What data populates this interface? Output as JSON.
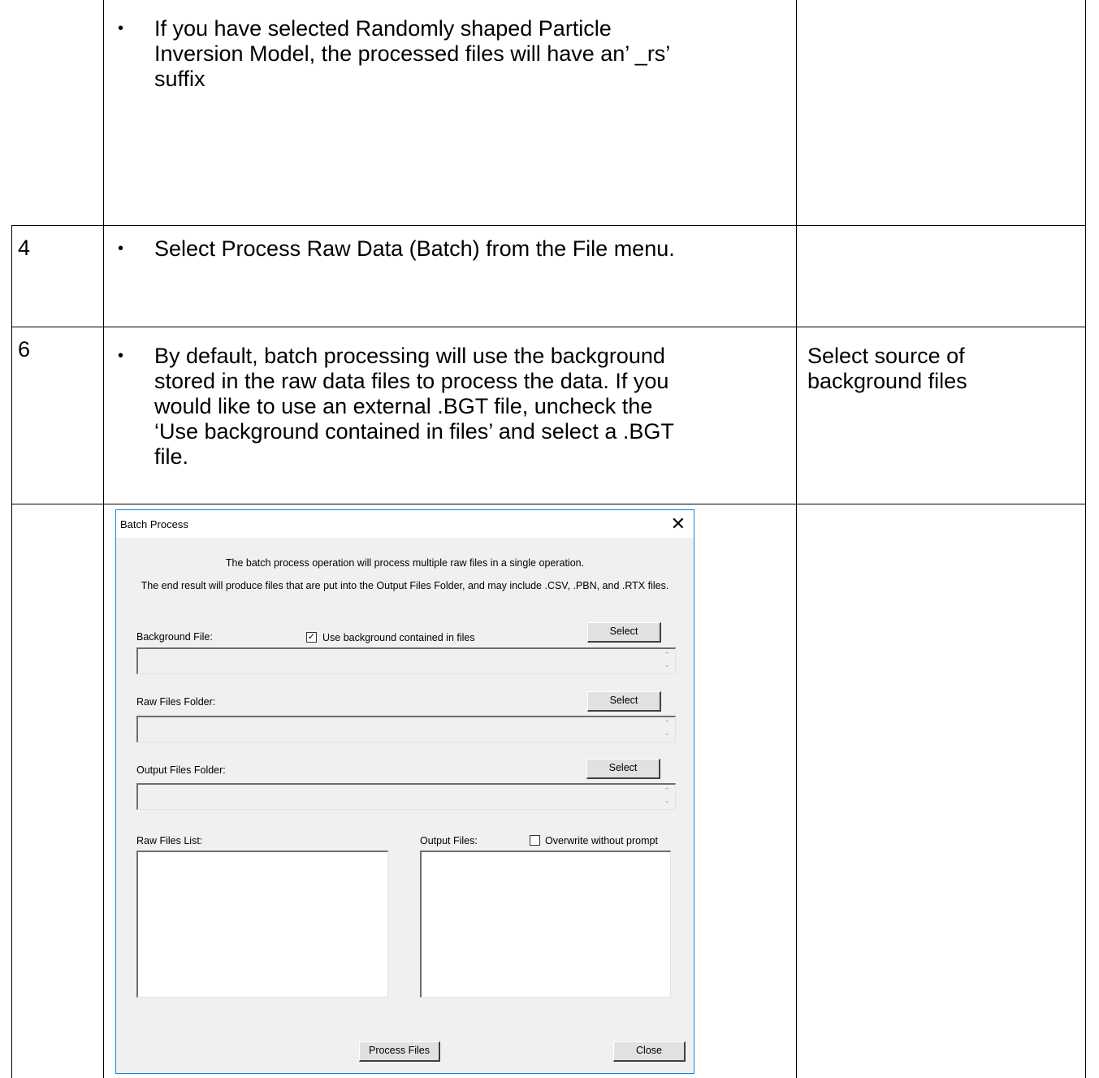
{
  "rows": [
    {
      "number": "",
      "bullet": "•",
      "text_lines": [
        "If you have selected Randomly shaped Particle",
        "Inversion Model, the processed files will have an’ _rs’",
        "suffix"
      ],
      "note_lines": []
    },
    {
      "number": "4",
      "bullet": "•",
      "text_lines": [
        "Select Process Raw Data (Batch) from the File menu."
      ],
      "note_lines": []
    },
    {
      "number": "6",
      "bullet": "•",
      "text_lines": [
        "By default, batch processing will use the background",
        "stored in the raw data files to process the data. If you",
        "would like to use an external .BGT file, uncheck the",
        "‘Use background contained in files’ and select a .BGT",
        "file."
      ],
      "note_lines": [
        "Select source of",
        "background files"
      ]
    }
  ],
  "dialog": {
    "title": "Batch Process",
    "close_glyph": "✕",
    "intro_line1": "The batch process operation will process multiple raw files in a single operation.",
    "intro_line2": "The end result will produce files that are put into the Output Files Folder, and may include .CSV, .PBN, and .RTX files.",
    "background_label": "Background File:",
    "use_background_label": "Use background contained in files",
    "use_background_checked": true,
    "raw_folder_label": "Raw Files Folder:",
    "output_folder_label": "Output Files Folder:",
    "select_label": "Select",
    "raw_list_label": "Raw Files List:",
    "output_files_label": "Output Files:",
    "overwrite_label": "Overwrite without prompt",
    "overwrite_checked": false,
    "process_button": "Process Files",
    "close_button": "Close",
    "spin_up": "⌃",
    "spin_down": "⌄",
    "check_mark": "✓"
  }
}
